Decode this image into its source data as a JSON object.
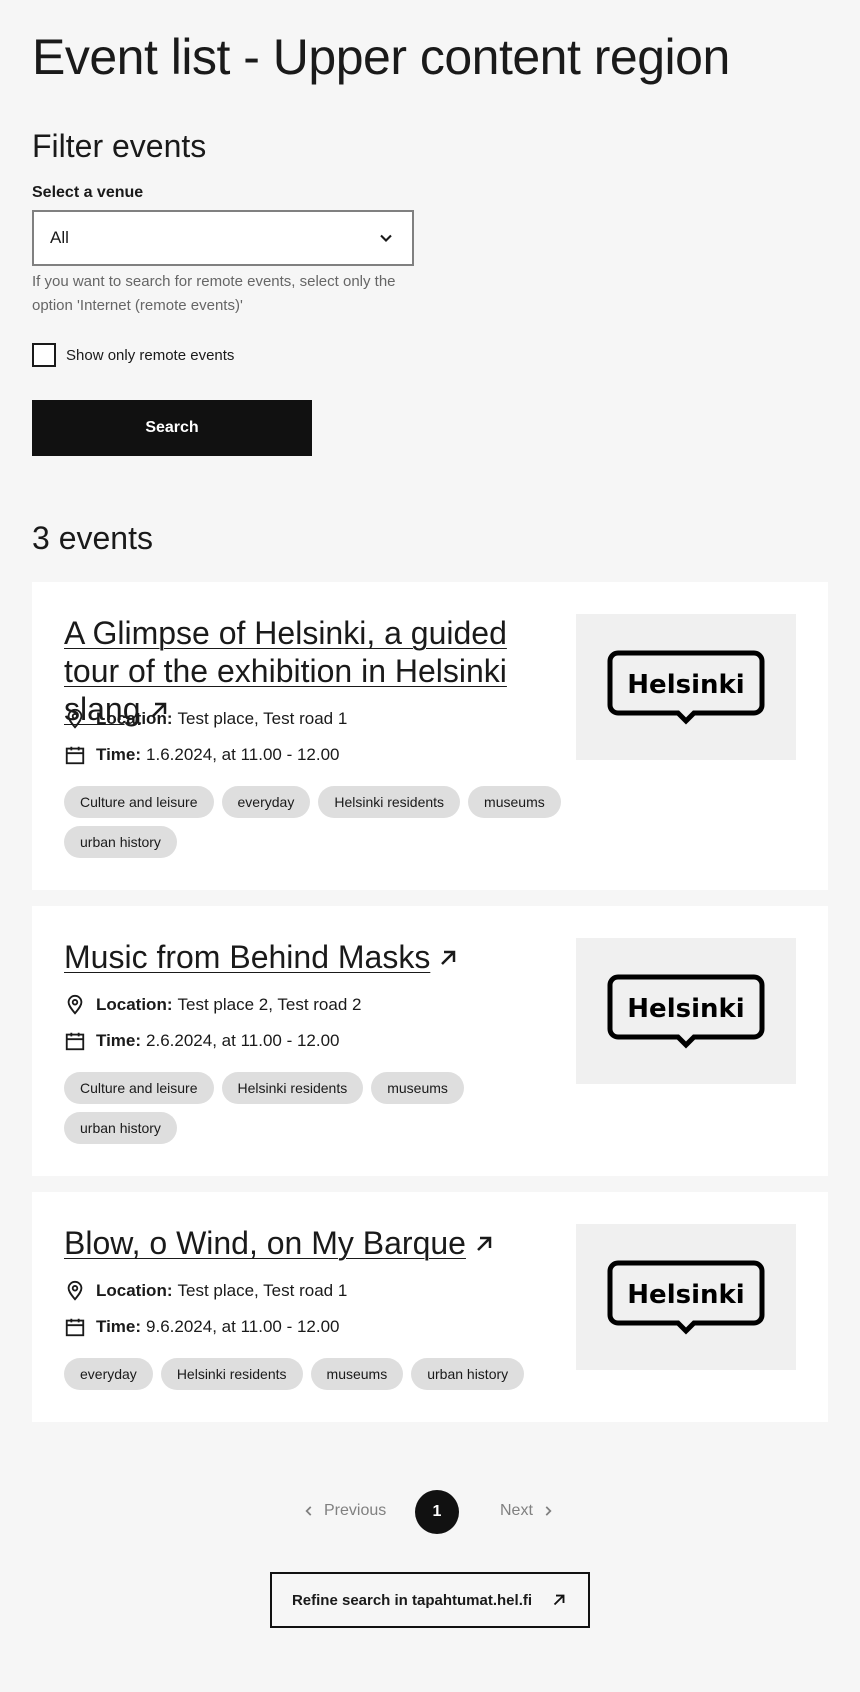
{
  "page_title": "Event list - Upper content region",
  "filter": {
    "heading": "Filter events",
    "venue_label": "Select a venue",
    "venue_value": "All",
    "helper_text": "If you want to search for remote events, select only the option 'Internet (remote events)'",
    "remote_checkbox_label": "Show only remote events",
    "remote_checked": false,
    "search_label": "Search"
  },
  "results_count": "3 events",
  "events": [
    {
      "title": "A Glimpse of Helsinki, a guided tour of the exhibition in Helsinki slang",
      "location_label": "Location:",
      "location": "Test place, Test road 1",
      "time_label": "Time:",
      "time": "1.6.2024, at 11.00 - 12.00",
      "tags": [
        "Culture and leisure",
        "everyday",
        "Helsinki residents",
        "museums",
        "urban history"
      ],
      "logo_text": "Helsinki"
    },
    {
      "title": "Music from Behind Masks",
      "location_label": "Location:",
      "location": "Test place 2, Test road 2",
      "time_label": "Time:",
      "time": "2.6.2024, at 11.00 - 12.00",
      "tags": [
        "Culture and leisure",
        "Helsinki residents",
        "museums",
        "urban history"
      ],
      "logo_text": "Helsinki"
    },
    {
      "title": "Blow, o Wind, on My Barque",
      "location_label": "Location:",
      "location": "Test place, Test road 1",
      "time_label": "Time:",
      "time": "9.6.2024, at 11.00 - 12.00",
      "tags": [
        "everyday",
        "Helsinki residents",
        "museums",
        "urban history"
      ],
      "logo_text": "Helsinki"
    }
  ],
  "pagination": {
    "previous_label": "Previous",
    "current_page": "1",
    "next_label": "Next"
  },
  "refine_label": "Refine search in tapahtumat.hel.fi",
  "colors": {
    "background": "#f6f6f6",
    "button_dark": "#111111",
    "tag_bg": "#dedede"
  }
}
